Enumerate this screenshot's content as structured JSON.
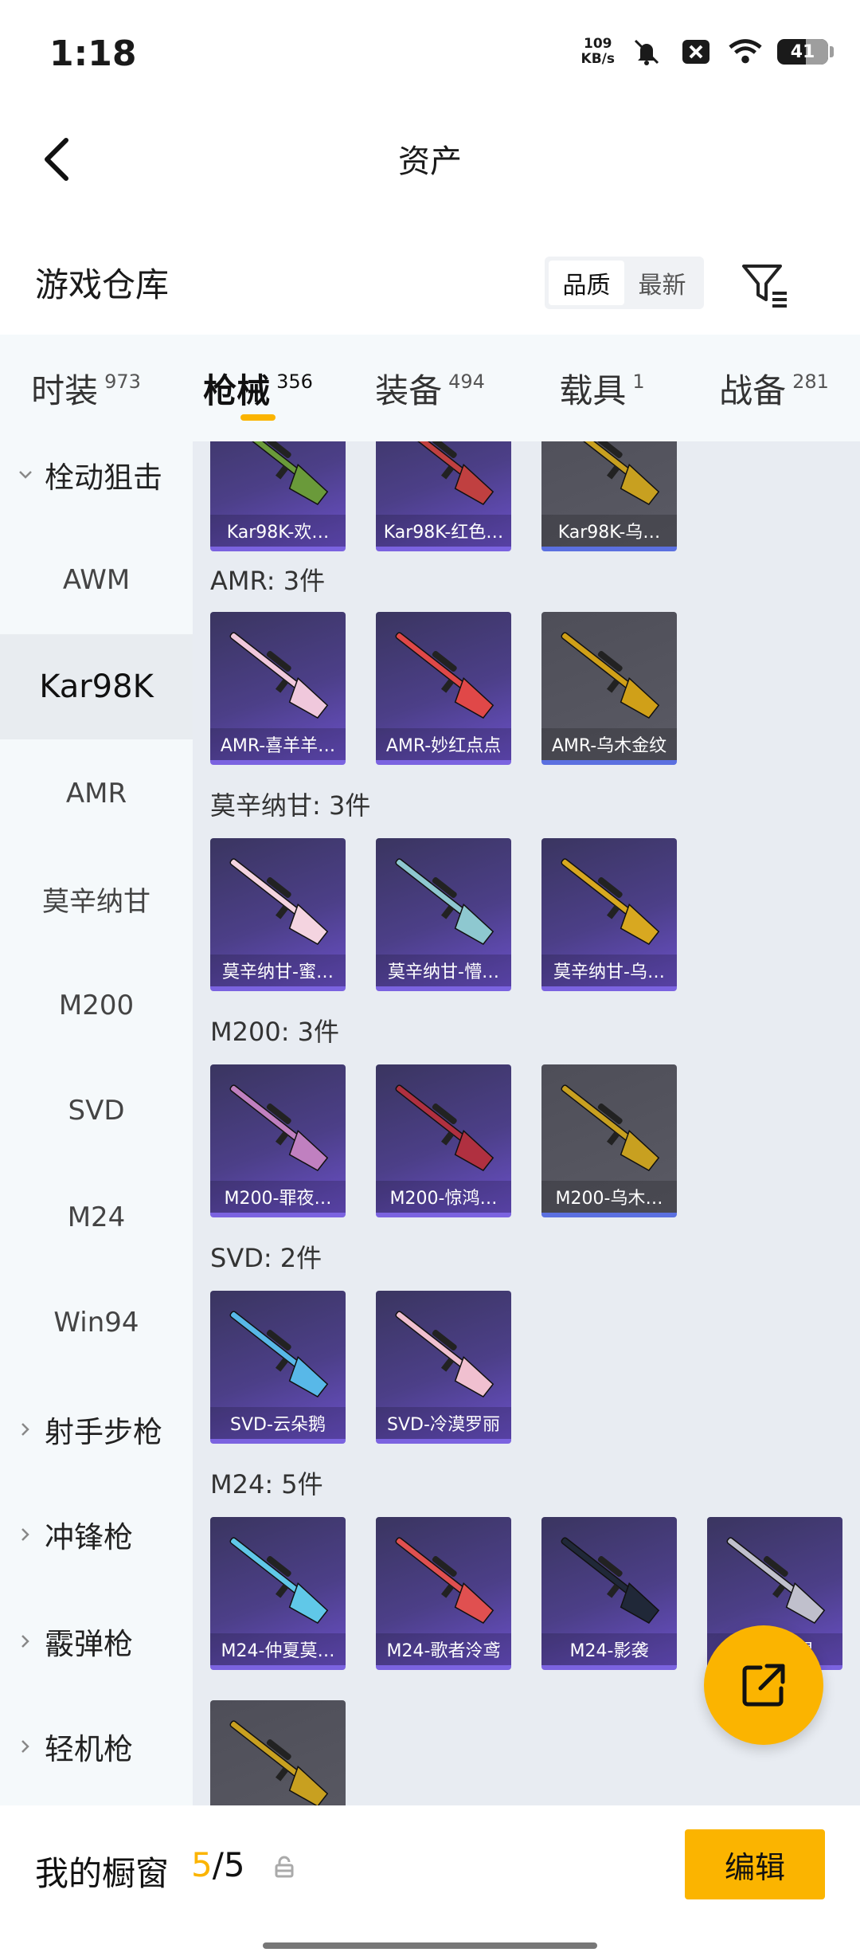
{
  "status": {
    "time": "1:18",
    "net_speed_value": "109",
    "net_speed_unit": "KB/s",
    "battery": "41",
    "icons": [
      "mute-icon",
      "close-box-icon",
      "wifi-icon",
      "battery-icon"
    ]
  },
  "header": {
    "title": "资产",
    "back_icon": "chevron-left-icon"
  },
  "warehouse": {
    "title": "游戏仓库",
    "sort": [
      {
        "label": "品质",
        "active": true
      },
      {
        "label": "最新",
        "active": false
      }
    ],
    "filter_icon": "filter-icon"
  },
  "tabs": [
    {
      "label": "时装",
      "count": "973",
      "active": false
    },
    {
      "label": "枪械",
      "count": "356",
      "active": true
    },
    {
      "label": "装备",
      "count": "494",
      "active": false
    },
    {
      "label": "载具",
      "count": "1",
      "active": false
    },
    {
      "label": "战备",
      "count": "281",
      "active": false
    }
  ],
  "sidebar": [
    {
      "label": "栓动狙击",
      "type": "group",
      "expanded": true
    },
    {
      "label": "AWM",
      "type": "item"
    },
    {
      "label": "Kar98K",
      "type": "item",
      "active": true
    },
    {
      "label": "AMR",
      "type": "item"
    },
    {
      "label": "莫辛纳甘",
      "type": "item"
    },
    {
      "label": "M200",
      "type": "item"
    },
    {
      "label": "SVD",
      "type": "item"
    },
    {
      "label": "M24",
      "type": "item"
    },
    {
      "label": "Win94",
      "type": "item"
    },
    {
      "label": "射手步枪",
      "type": "group",
      "expanded": false
    },
    {
      "label": "冲锋枪",
      "type": "group",
      "expanded": false
    },
    {
      "label": "霰弹枪",
      "type": "group",
      "expanded": false
    },
    {
      "label": "轻机枪",
      "type": "group",
      "expanded": false
    }
  ],
  "sections": [
    {
      "title": "",
      "items": [
        {
          "name": "Kar98K-欢…",
          "style": "purple",
          "gun_color": "#6a9a3a"
        },
        {
          "name": "Kar98K-红色…",
          "style": "purple",
          "gun_color": "#c04040"
        },
        {
          "name": "Kar98K-乌…",
          "style": "gray",
          "gun_color": "#c8a020"
        }
      ]
    },
    {
      "title": "AMR: 3件",
      "items": [
        {
          "name": "AMR-喜羊羊…",
          "style": "purple",
          "gun_color": "#f0c8dc"
        },
        {
          "name": "AMR-妙红点点",
          "style": "purple",
          "gun_color": "#e04848"
        },
        {
          "name": "AMR-乌木金纹",
          "style": "gray",
          "gun_color": "#d0a018"
        }
      ]
    },
    {
      "title": "莫辛纳甘: 3件",
      "items": [
        {
          "name": "莫辛纳甘-蜜…",
          "style": "purple",
          "gun_color": "#f4d4e0"
        },
        {
          "name": "莫辛纳甘-懵…",
          "style": "purple",
          "gun_color": "#8ec8d0"
        },
        {
          "name": "莫辛纳甘-乌…",
          "style": "purple",
          "gun_color": "#d8a820"
        }
      ]
    },
    {
      "title": "M200: 3件",
      "items": [
        {
          "name": "M200-罪夜…",
          "style": "purple",
          "gun_color": "#c080c0"
        },
        {
          "name": "M200-惊鸿…",
          "style": "purple",
          "gun_color": "#b03040"
        },
        {
          "name": "M200-乌木…",
          "style": "gray",
          "gun_color": "#c8a020"
        }
      ]
    },
    {
      "title": "SVD: 2件",
      "items": [
        {
          "name": "SVD-云朵鹅",
          "style": "purple",
          "gun_color": "#58b8e8"
        },
        {
          "name": "SVD-冷漠罗丽",
          "style": "purple",
          "gun_color": "#f0c0d0"
        }
      ]
    },
    {
      "title": "M24: 5件",
      "items": [
        {
          "name": "M24-仲夏莫…",
          "style": "purple",
          "gun_color": "#60c8e8"
        },
        {
          "name": "M24-歌者泠鸢",
          "style": "purple",
          "gun_color": "#e05050"
        },
        {
          "name": "M24-影袭",
          "style": "purple",
          "gun_color": "#202838"
        },
        {
          "name": "M24-…星",
          "style": "purple",
          "gun_color": "#c0c0cc"
        },
        {
          "name": "",
          "style": "gray",
          "gun_color": "#c8a020"
        }
      ]
    }
  ],
  "fab": {
    "icon": "share-external-icon"
  },
  "bottom": {
    "title": "我的橱窗",
    "count_current": "5",
    "count_sep_total": "/5",
    "lock_icon": "lock-icon",
    "edit_label": "编辑"
  },
  "colors": {
    "accent": "#fbb400",
    "card_purple": "#4c3f88",
    "card_gray": "#5a5a64"
  }
}
